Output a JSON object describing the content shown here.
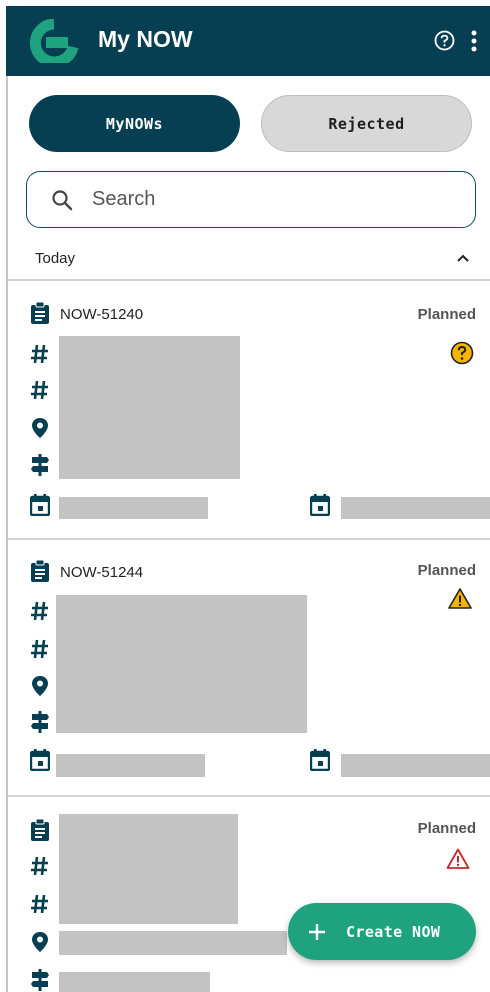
{
  "app": {
    "title": "My NOW"
  },
  "tabs": [
    {
      "label": "MyNOWs",
      "active": true
    },
    {
      "label": "Rejected",
      "active": false
    }
  ],
  "search": {
    "placeholder": "Search"
  },
  "section": {
    "label": "Today",
    "expanded": true
  },
  "cards": [
    {
      "id": "NOW-51240",
      "status": "Planned",
      "flag": "help-circle"
    },
    {
      "id": "NOW-51244",
      "status": "Planned",
      "flag": "warning-filled"
    },
    {
      "id": "",
      "status": "Planned",
      "flag": "warning-outline"
    }
  ],
  "fab": {
    "label": "Create NOW"
  },
  "colors": {
    "primary": "#073f52",
    "accent": "#1fa37f",
    "tab_inactive": "#d8d8d8",
    "redaction": "#c3c3c3",
    "help_yellow": "#f4b400",
    "warning_red": "#c62828"
  }
}
